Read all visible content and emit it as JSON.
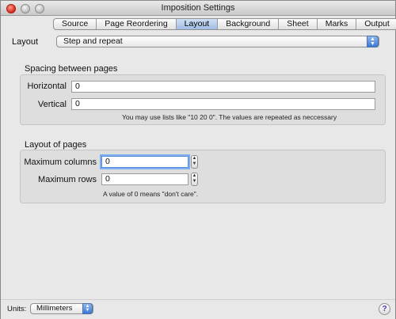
{
  "window": {
    "title": "Imposition Settings"
  },
  "tabs": [
    {
      "label": "Source"
    },
    {
      "label": "Page Reordering"
    },
    {
      "label": "Layout"
    },
    {
      "label": "Background"
    },
    {
      "label": "Sheet"
    },
    {
      "label": "Marks"
    },
    {
      "label": "Output"
    }
  ],
  "active_tab": "Layout",
  "layout": {
    "label": "Layout",
    "value": "Step and repeat"
  },
  "spacing": {
    "title": "Spacing between pages",
    "horizontal_label": "Horizontal",
    "horizontal_value": "0",
    "vertical_label": "Vertical",
    "vertical_value": "0",
    "hint": "You may use lists like \"10 20 0\". The values are repeated as neccessary"
  },
  "pages_layout": {
    "title": "Layout of pages",
    "max_columns_label": "Maximum columns",
    "max_columns_value": "0",
    "max_rows_label": "Maximum rows",
    "max_rows_value": "0",
    "hint": "A value of 0 means \"don't care\"."
  },
  "bottom": {
    "units_label": "Units:",
    "units_value": "Millimeters",
    "help_glyph": "?"
  },
  "icons": {
    "close": "close-icon",
    "minimize": "minimize-icon",
    "zoom": "zoom-icon",
    "popup_arrows": "popup-arrows-icon",
    "stepper": "stepper-icon",
    "help": "help-icon"
  }
}
